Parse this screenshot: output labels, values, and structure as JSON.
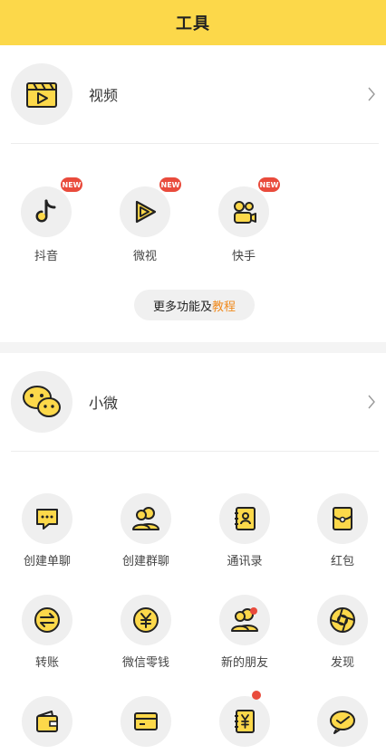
{
  "header": {
    "title": "工具"
  },
  "video_section": {
    "title": "视频",
    "apps": [
      {
        "label": "抖音",
        "badge": "NEW",
        "icon": "douyin-icon"
      },
      {
        "label": "微视",
        "badge": "NEW",
        "icon": "weishi-icon"
      },
      {
        "label": "快手",
        "badge": "NEW",
        "icon": "kuaishou-icon"
      }
    ],
    "more_prefix": "更多功能及",
    "more_highlight": "教程"
  },
  "wechat_section": {
    "title": "小微",
    "items": [
      {
        "label": "创建单聊",
        "icon": "single-chat-icon"
      },
      {
        "label": "创建群聊",
        "icon": "group-chat-icon"
      },
      {
        "label": "通讯录",
        "icon": "contacts-icon"
      },
      {
        "label": "红包",
        "icon": "red-packet-icon"
      },
      {
        "label": "转账",
        "icon": "transfer-icon"
      },
      {
        "label": "微信零钱",
        "icon": "wallet-change-icon"
      },
      {
        "label": "新的朋友",
        "icon": "new-friends-icon"
      },
      {
        "label": "发现",
        "icon": "discover-icon"
      }
    ],
    "bottom_row_icons": [
      "wallet-icon",
      "card-icon",
      "bill-icon",
      "moments-icon"
    ]
  },
  "colors": {
    "accent": "#fcd84a",
    "icon_stroke": "#222222",
    "badge": "#e94b3c",
    "highlight": "#f08a1d"
  }
}
